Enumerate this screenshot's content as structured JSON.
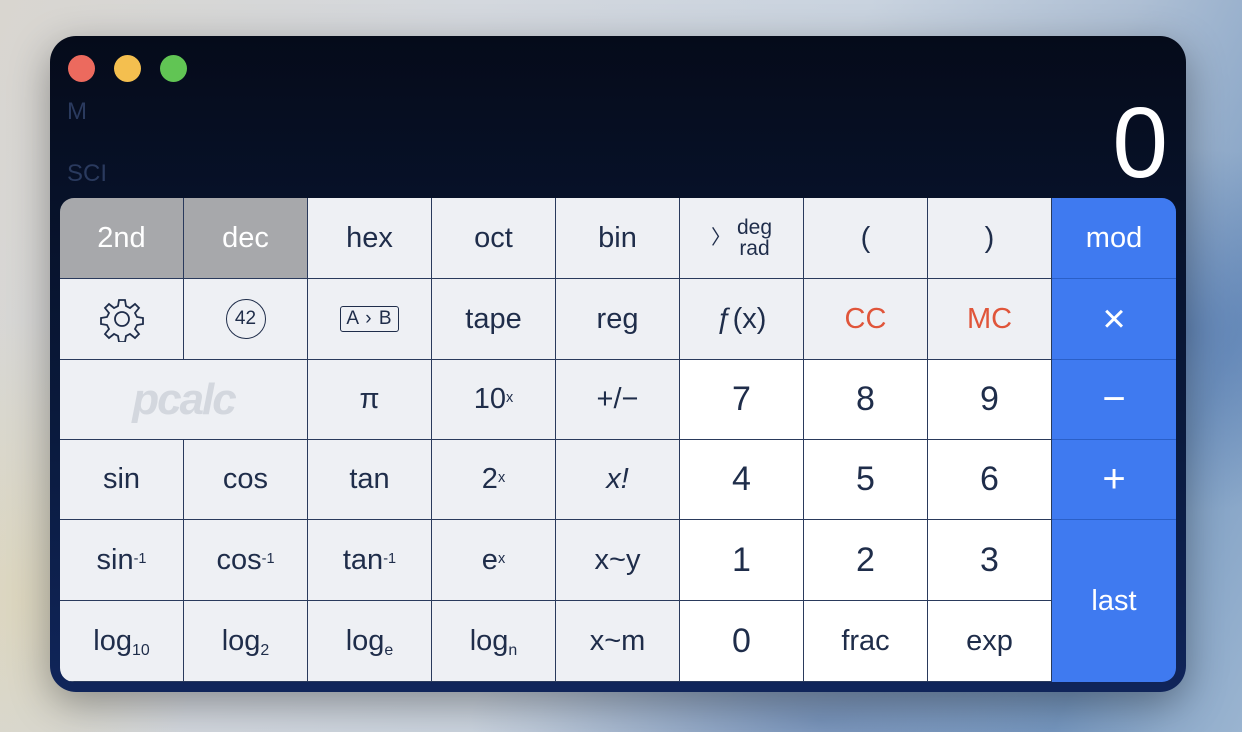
{
  "display": {
    "value": "0",
    "memory_indicator": "M",
    "mode_indicator": "SCI"
  },
  "colors": {
    "accent_blue": "#3f7af0",
    "clear_red": "#e0553a",
    "toggle_gray": "#a7a8ab"
  },
  "keys": {
    "second": "2nd",
    "dec": "dec",
    "hex": "hex",
    "oct": "oct",
    "bin": "bin",
    "deg": "deg",
    "rad": "rad",
    "deg_rad_chevron": "〉",
    "open_paren": "(",
    "close_paren": ")",
    "mod": "mod",
    "settings_icon": "gear-icon",
    "constants": "42",
    "a_to_b": "A › B",
    "tape": "tape",
    "reg": "reg",
    "function": "ƒ(x)",
    "cc": "CC",
    "mc": "MC",
    "multiply": "×",
    "logo": "pcalc",
    "pi": "π",
    "ten_pow_base": "10",
    "ten_pow_exp": "x",
    "plus_minus": "+/−",
    "seven": "7",
    "eight": "8",
    "nine": "9",
    "minus": "−",
    "sin": "sin",
    "cos": "cos",
    "tan": "tan",
    "two_pow_base": "2",
    "two_pow_exp": "x",
    "factorial": "x!",
    "four": "4",
    "five": "5",
    "six": "6",
    "plus": "+",
    "asin_base": "sin",
    "asin_exp": "-1",
    "acos_base": "cos",
    "acos_exp": "-1",
    "atan_base": "tan",
    "atan_exp": "-1",
    "e_pow_base": "e",
    "e_pow_exp": "x",
    "x_swap_y": "x~y",
    "one": "1",
    "two": "2",
    "three": "3",
    "last": "last",
    "log10_base": "log",
    "log10_sub": "10",
    "log2_base": "log",
    "log2_sub": "2",
    "loge_base": "log",
    "loge_sub": "e",
    "logn_base": "log",
    "logn_sub": "n",
    "x_swap_m": "x~m",
    "zero": "0",
    "frac": "frac",
    "exp": "exp"
  }
}
